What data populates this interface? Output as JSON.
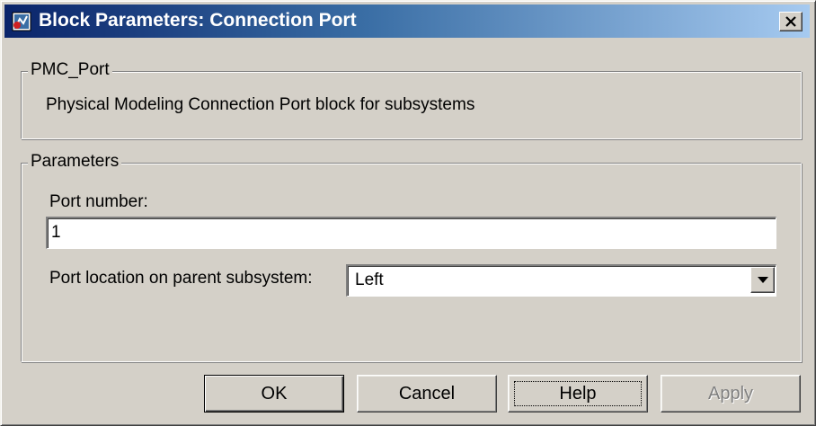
{
  "window": {
    "title": "Block Parameters: Connection Port",
    "icon": "simulink-block-icon",
    "close_icon": "close-icon"
  },
  "description_group": {
    "legend": "PMC_Port",
    "text": "Physical Modeling Connection Port block for subsystems"
  },
  "parameters_group": {
    "legend": "Parameters",
    "port_number_label": "Port number:",
    "port_number_value": "1",
    "port_location_label": "Port location on parent subsystem:",
    "port_location_value": "Left",
    "dropdown_icon": "chevron-down-icon"
  },
  "buttons": {
    "ok": "OK",
    "cancel": "Cancel",
    "help": "Help",
    "apply": "Apply"
  },
  "colors": {
    "title_start": "#0a246a",
    "title_end": "#a6caf0",
    "dialog_face": "#d4d0c8"
  }
}
